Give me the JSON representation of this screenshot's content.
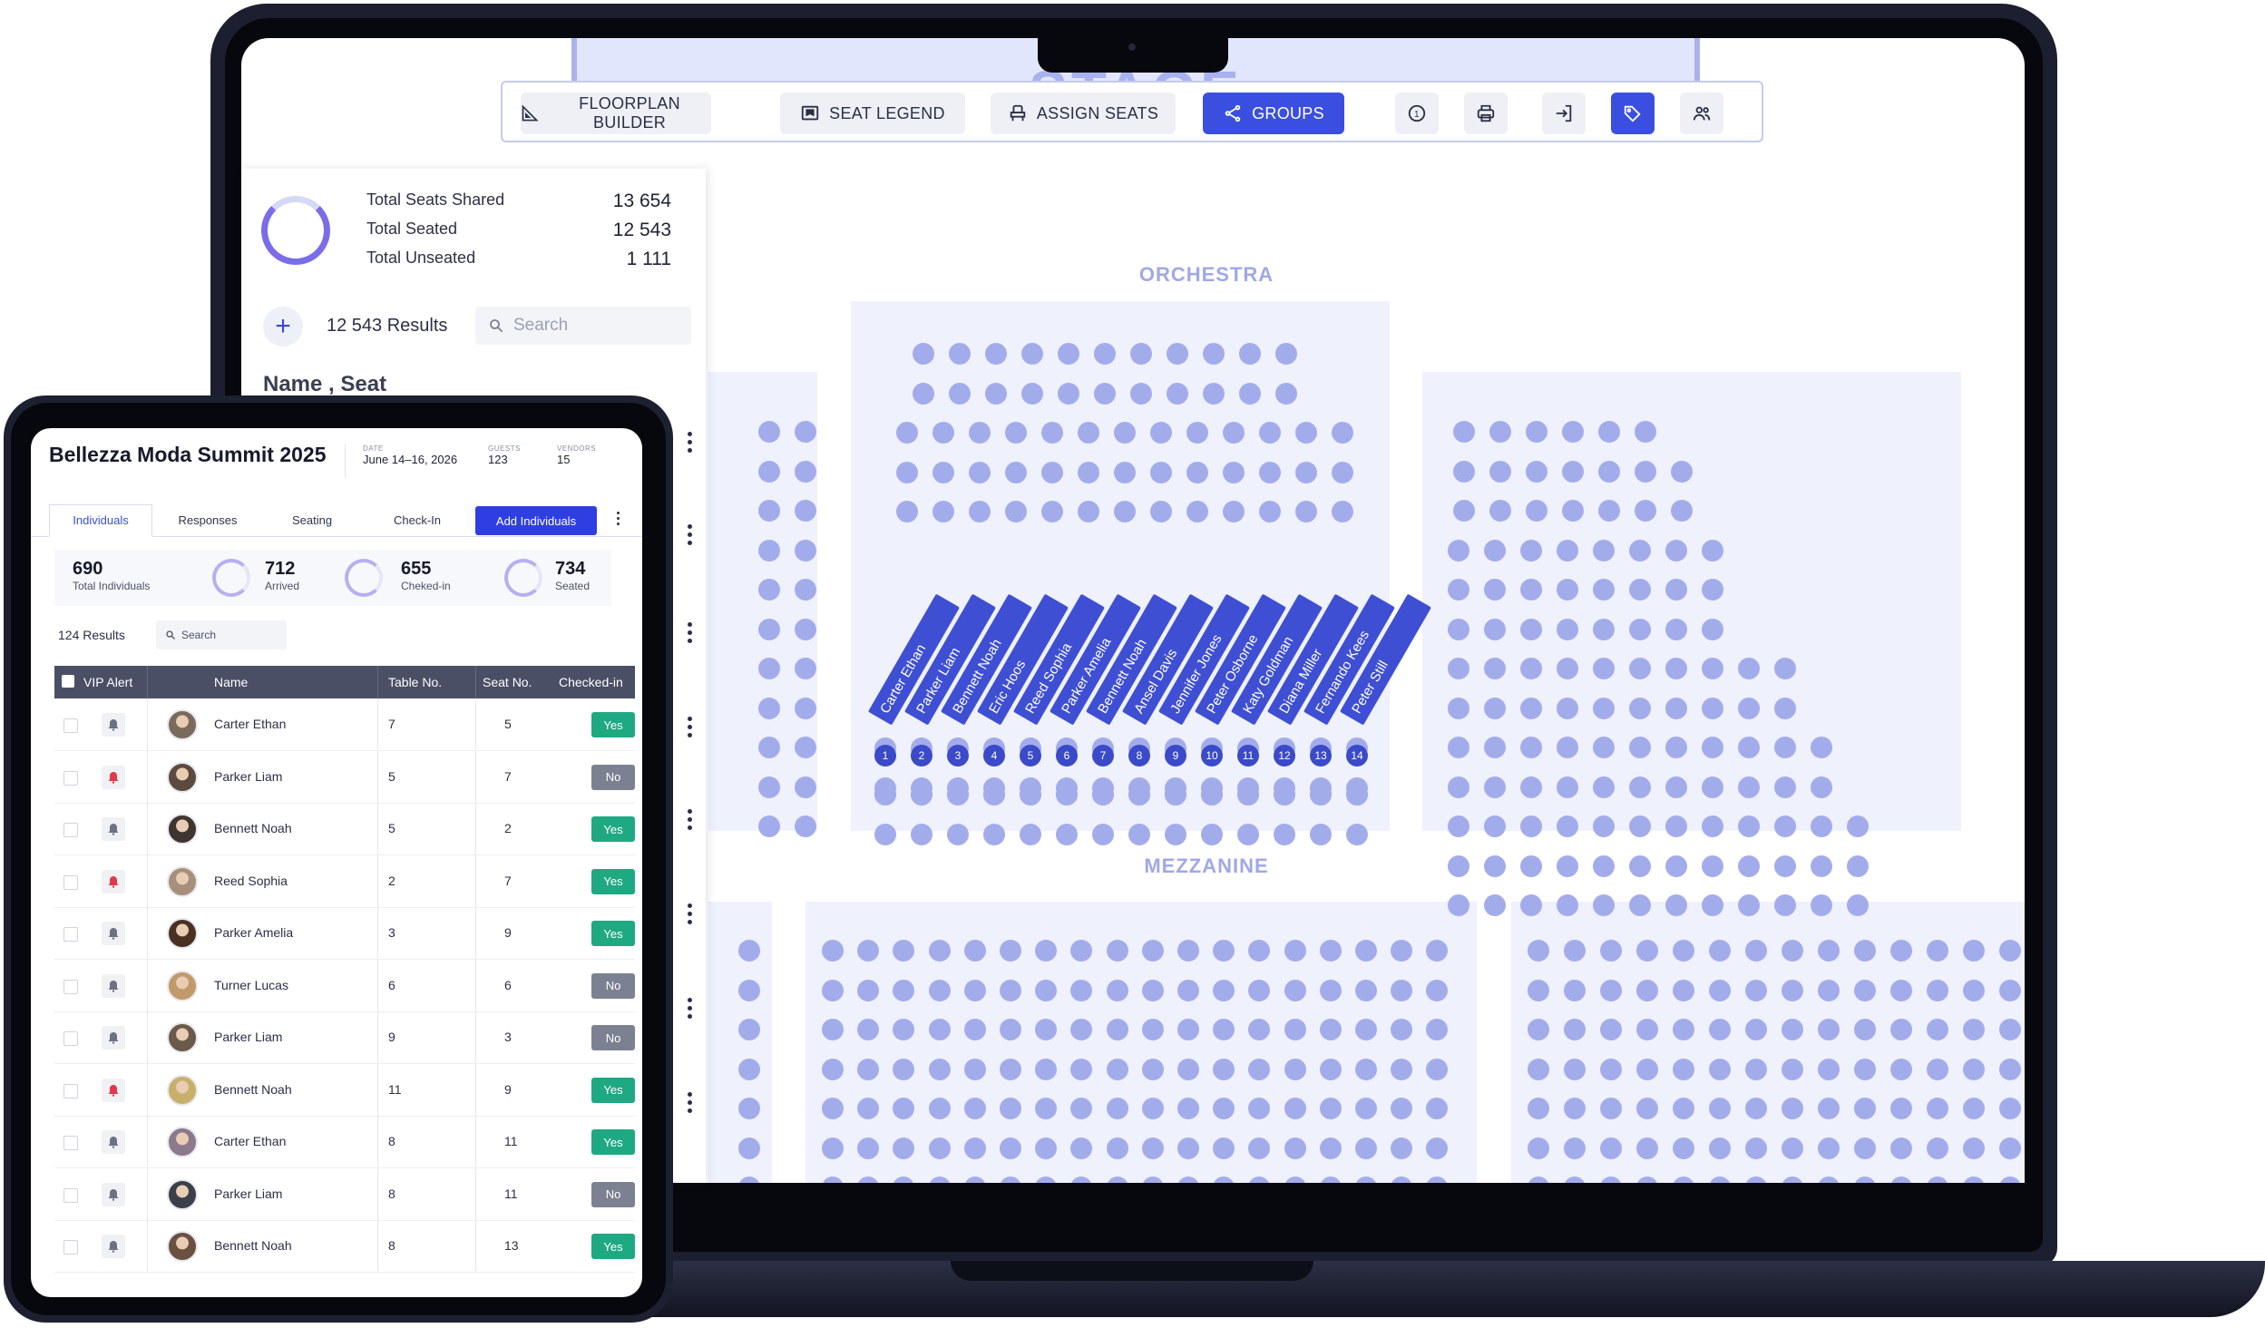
{
  "toolbar": {
    "buttons": [
      {
        "label": "FLOORPLAN BUILDER",
        "icon": "floorplan-ruler-icon",
        "active": false
      },
      {
        "label": "SEAT LEGEND",
        "icon": "legend-flag-icon",
        "active": false
      },
      {
        "label": "ASSIGN SEATS",
        "icon": "seat-icon",
        "active": false
      },
      {
        "label": "GROUPS",
        "icon": "share-nodes-icon",
        "active": true
      }
    ],
    "icon_buttons": [
      {
        "icon": "info-circle-icon",
        "glyph": "1"
      },
      {
        "icon": "printer-icon"
      },
      {
        "icon": "sign-in-icon"
      },
      {
        "icon": "tags-icon",
        "active": true
      },
      {
        "icon": "users-icon"
      }
    ]
  },
  "stage": {
    "label": "STAGE"
  },
  "sections": {
    "orchestra": "ORCHESTRA",
    "mezzanine": "MEZZANINE"
  },
  "group": {
    "names": [
      "Carter Ethan",
      "Parker Liam",
      "Bennett Noah",
      "Eric Hoos",
      "Reed Sophia",
      "Parker Amelia",
      "Bennett Noah",
      "Ansel Davis",
      "Jennifer Jones",
      "Peter Osborne",
      "Katy Goldman",
      "Diana Miller",
      "Fernando Kees",
      "Peter Still"
    ],
    "numbers": [
      "1",
      "2",
      "3",
      "4",
      "5",
      "6",
      "7",
      "8",
      "9",
      "10",
      "11",
      "12",
      "13",
      "14"
    ]
  },
  "side_panel": {
    "stats": [
      {
        "label": "Total Seats Shared",
        "value": "13 654"
      },
      {
        "label": "Total Seated",
        "value": "12 543"
      },
      {
        "label": "Total Unseated",
        "value": "1 111"
      }
    ],
    "results": "12 543 Results",
    "search_placeholder": "Search",
    "list_header": "Name , Seat"
  },
  "tablet": {
    "title": "Bellezza Moda Summit 2025",
    "meta": [
      {
        "label": "DATE",
        "value": "June 14–16, 2026"
      },
      {
        "label": "GUESTS",
        "value": "123"
      },
      {
        "label": "VENDORS",
        "value": "15"
      }
    ],
    "tabs": [
      "Individuals",
      "Responses",
      "Seating",
      "Check-In"
    ],
    "add_button": "Add Individuals",
    "summary": [
      {
        "value": "690",
        "label": "Total Individuals"
      },
      {
        "value": "712",
        "label": "Arrived"
      },
      {
        "value": "655",
        "label": "Cheked-in"
      },
      {
        "value": "734",
        "label": "Seated"
      }
    ],
    "results": "124 Results",
    "search_placeholder": "Search",
    "columns": [
      "VIP Alert",
      "Name",
      "Table No.",
      "Seat No.",
      "Checked-in"
    ],
    "rows": [
      {
        "vip": false,
        "name": "Carter Ethan",
        "table": "7",
        "seat": "5",
        "checked": "Yes",
        "avatar": "#7a6a5c"
      },
      {
        "vip": true,
        "name": "Parker Liam",
        "table": "5",
        "seat": "7",
        "checked": "No",
        "avatar": "#5c4a3e"
      },
      {
        "vip": false,
        "name": "Bennett Noah",
        "table": "5",
        "seat": "2",
        "checked": "Yes",
        "avatar": "#3e3430"
      },
      {
        "vip": true,
        "name": "Reed Sophia",
        "table": "2",
        "seat": "7",
        "checked": "Yes",
        "avatar": "#a88f7c"
      },
      {
        "vip": false,
        "name": "Parker Amelia",
        "table": "3",
        "seat": "9",
        "checked": "Yes",
        "avatar": "#4a3020"
      },
      {
        "vip": false,
        "name": "Turner Lucas",
        "table": "6",
        "seat": "6",
        "checked": "No",
        "avatar": "#c29a6a"
      },
      {
        "vip": false,
        "name": "Parker Liam",
        "table": "9",
        "seat": "3",
        "checked": "No",
        "avatar": "#6a5a4a"
      },
      {
        "vip": true,
        "name": "Bennett Noah",
        "table": "11",
        "seat": "9",
        "checked": "Yes",
        "avatar": "#c8b06a"
      },
      {
        "vip": false,
        "name": "Carter Ethan",
        "table": "8",
        "seat": "11",
        "checked": "Yes",
        "avatar": "#8a7a8c"
      },
      {
        "vip": false,
        "name": "Parker Liam",
        "table": "8",
        "seat": "11",
        "checked": "No",
        "avatar": "#3a3f4a"
      },
      {
        "vip": false,
        "name": "Bennett Noah",
        "table": "8",
        "seat": "13",
        "checked": "Yes",
        "avatar": "#6a5040"
      }
    ]
  },
  "colors": {
    "accent": "#3a4fe0",
    "seat": "#a3aceb",
    "seat_block": "#eff1fd",
    "yes": "#1fa982",
    "no": "#7c8192",
    "vip_alert": "#e03a4a"
  }
}
